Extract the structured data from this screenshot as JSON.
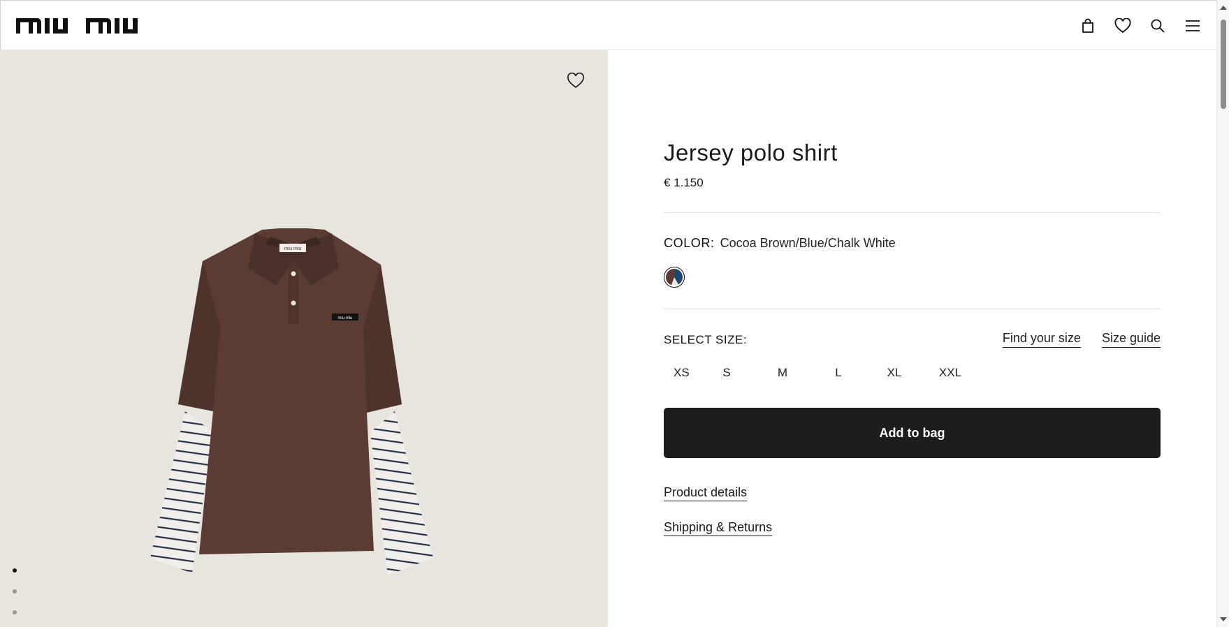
{
  "brand": {
    "logo_text": "miu miu"
  },
  "header": {
    "icons": [
      "bag-icon",
      "heart-icon",
      "search-icon",
      "menu-icon"
    ]
  },
  "gallery": {
    "wishlist_icon": "heart-icon",
    "image": "Jersey polo shirt",
    "slides": 5,
    "active_slide": 1
  },
  "product": {
    "title": "Jersey polo shirt",
    "price": "€ 1.150",
    "color_label": "COLOR:",
    "color_value": "Cocoa Brown/Blue/Chalk White",
    "size_label": "SELECT SIZE:",
    "find_size": "Find your size",
    "size_guide": "Size guide",
    "sizes": [
      "XS",
      "S",
      "M",
      "L",
      "XL",
      "XXL"
    ],
    "add_to_bag": "Add to bag",
    "details_link": "Product details",
    "shipping_link": "Shipping & Returns"
  },
  "colors": {
    "button_bg": "#1c1d1f",
    "gallery_bg": "#e8e4de",
    "shirt": "#5a3b33"
  }
}
